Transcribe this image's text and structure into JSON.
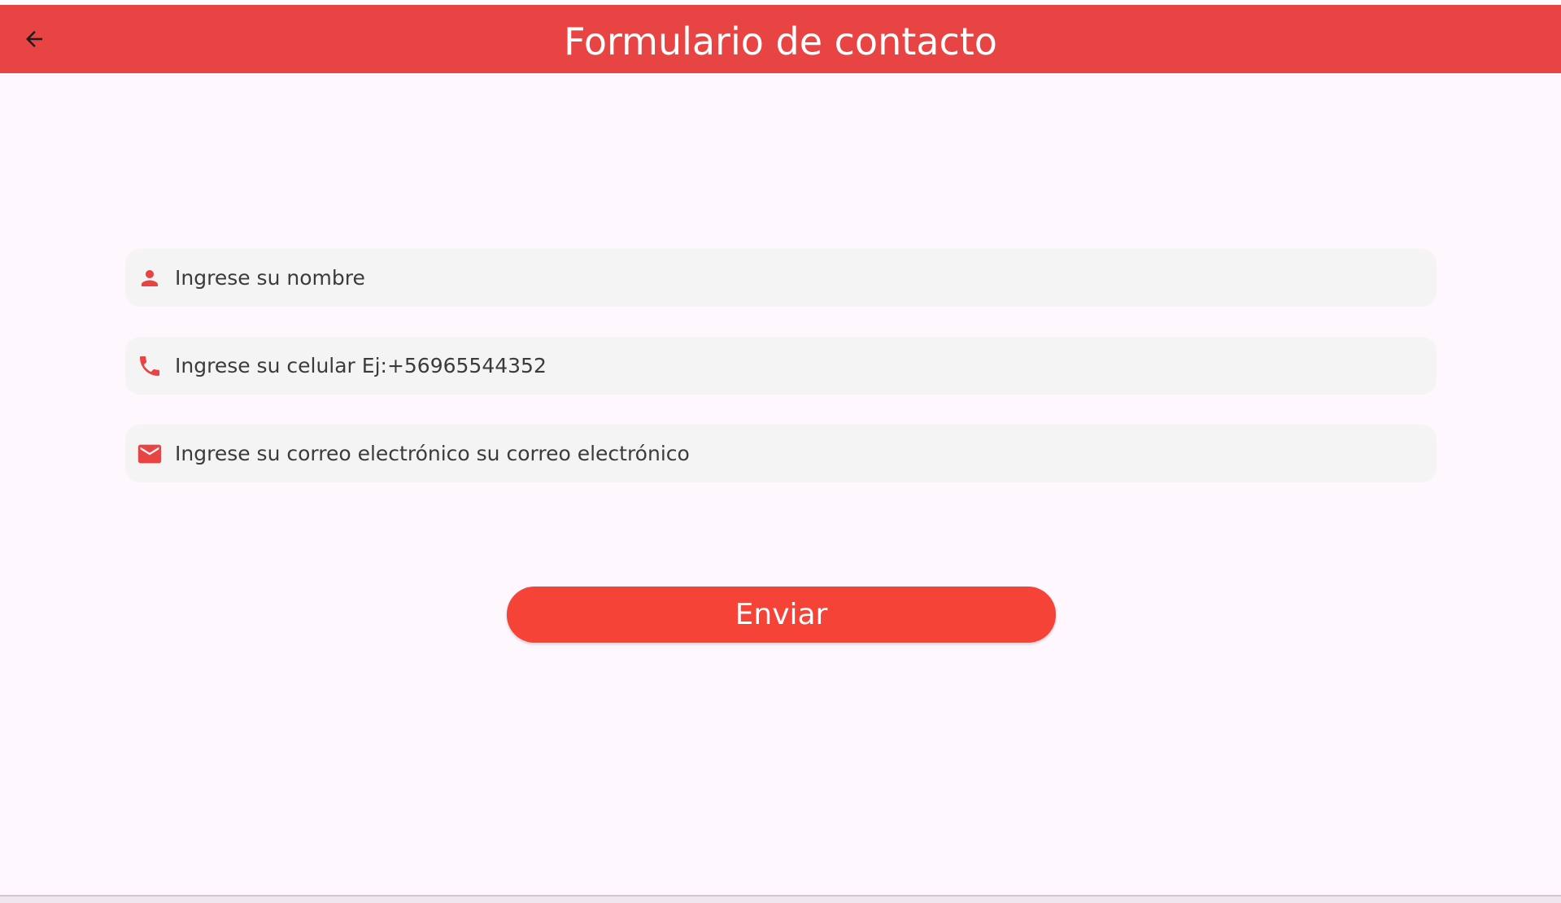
{
  "app_bar": {
    "title": "Formulario de contacto",
    "back_icon": "arrow-back-icon",
    "color": "#e84443"
  },
  "form": {
    "name_field": {
      "icon": "person-icon",
      "placeholder": "Ingrese su nombre",
      "value": ""
    },
    "phone_field": {
      "icon": "phone-icon",
      "placeholder": "Ingrese su celular Ej:+56965544352",
      "value": ""
    },
    "email_field": {
      "icon": "email-icon",
      "placeholder": "Ingrese su correo electrónico su correo electrónico",
      "value": ""
    },
    "icon_color": "#e84443"
  },
  "submit": {
    "label": "Enviar",
    "color": "#f54337"
  }
}
